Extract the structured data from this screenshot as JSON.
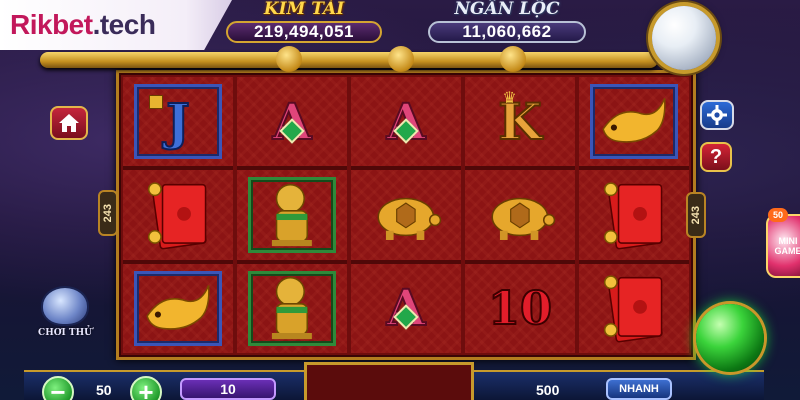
{
  "brand": {
    "name": "Rikbet",
    "tld": ".tech"
  },
  "jackpots": [
    {
      "title": "KIM TÀI",
      "value": "219,494,051"
    },
    {
      "title": "NGÂN LỘC",
      "value": "11,060,662"
    }
  ],
  "ways": {
    "left": "243",
    "right": "243"
  },
  "reels": [
    [
      "J",
      "red-envelope",
      "golden-carp"
    ],
    [
      "A",
      "golden-foo-dog",
      "golden-foo-dog"
    ],
    [
      "A",
      "golden-turtle",
      "A"
    ],
    [
      "K",
      "golden-turtle",
      "10"
    ],
    [
      "golden-carp",
      "red-envelope",
      "red-envelope"
    ]
  ],
  "side": {
    "trial_label": "CHƠI THỬ",
    "help_label": "?",
    "mini_badge": "50",
    "mini_label_1": "MINI",
    "mini_label_2": "GAME"
  },
  "bottom": {
    "bet_value": "50",
    "lines_value": "10",
    "total_value": "500",
    "fast_label": "NHANH",
    "minus": "−",
    "plus": "+"
  },
  "colors": {
    "brand": "#c2185b",
    "reel_bg": "#8c1414",
    "gold": "#c79a2c"
  }
}
